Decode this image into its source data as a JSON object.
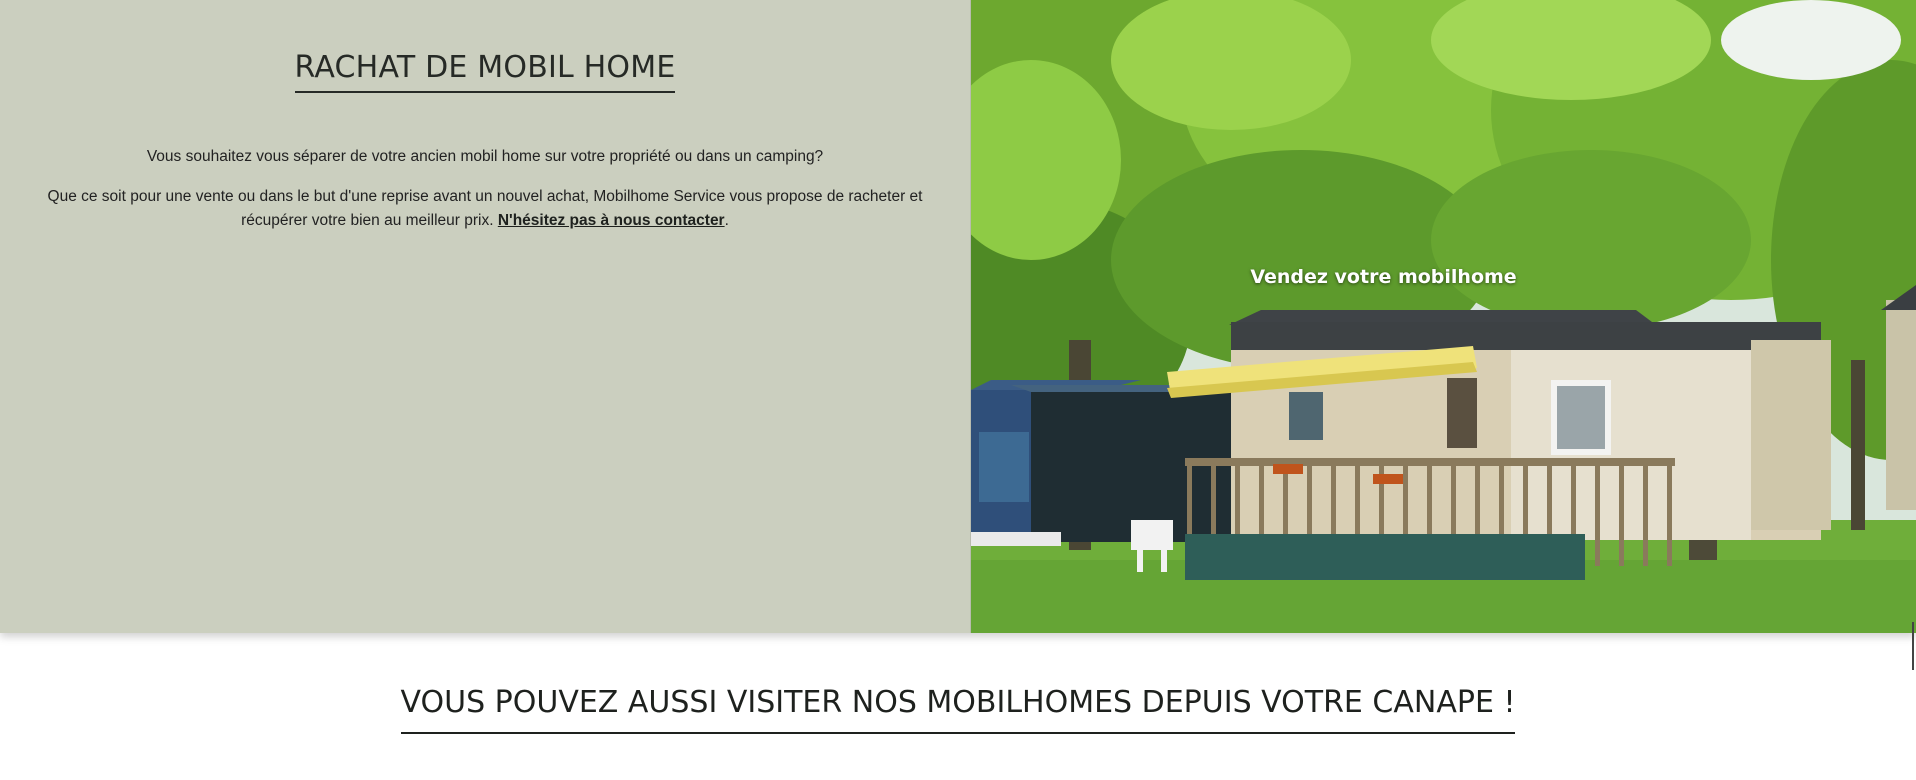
{
  "rachat": {
    "title": "RACHAT DE MOBIL HOME",
    "paragraph1": "Vous souhaitez vous séparer de votre ancien mobil home sur votre propriété ou dans un camping?",
    "paragraph2_text": "Que ce soit pour une vente ou dans le but d'une reprise avant un nouvel achat, Mobilhome Service vous propose de racheter et récupérer votre bien au meilleur prix. ",
    "contact_link": "N'hésitez pas à nous contacter",
    "paragraph2_end": "."
  },
  "hero_image": {
    "caption": "Vendez votre mobilhome"
  },
  "visit": {
    "title": "VOUS POUVEZ AUSSI VISITER NOS MOBILHOMES DEPUIS VOTRE CANAPE !"
  },
  "colors": {
    "left_panel_bg": "#cbcfbf",
    "title_text": "#262a26",
    "grass": "#6fae3a",
    "foliage": "#7fbf3a",
    "mobilhome_siding": "#d9cfb4",
    "awning_yellow": "#efe27a"
  }
}
